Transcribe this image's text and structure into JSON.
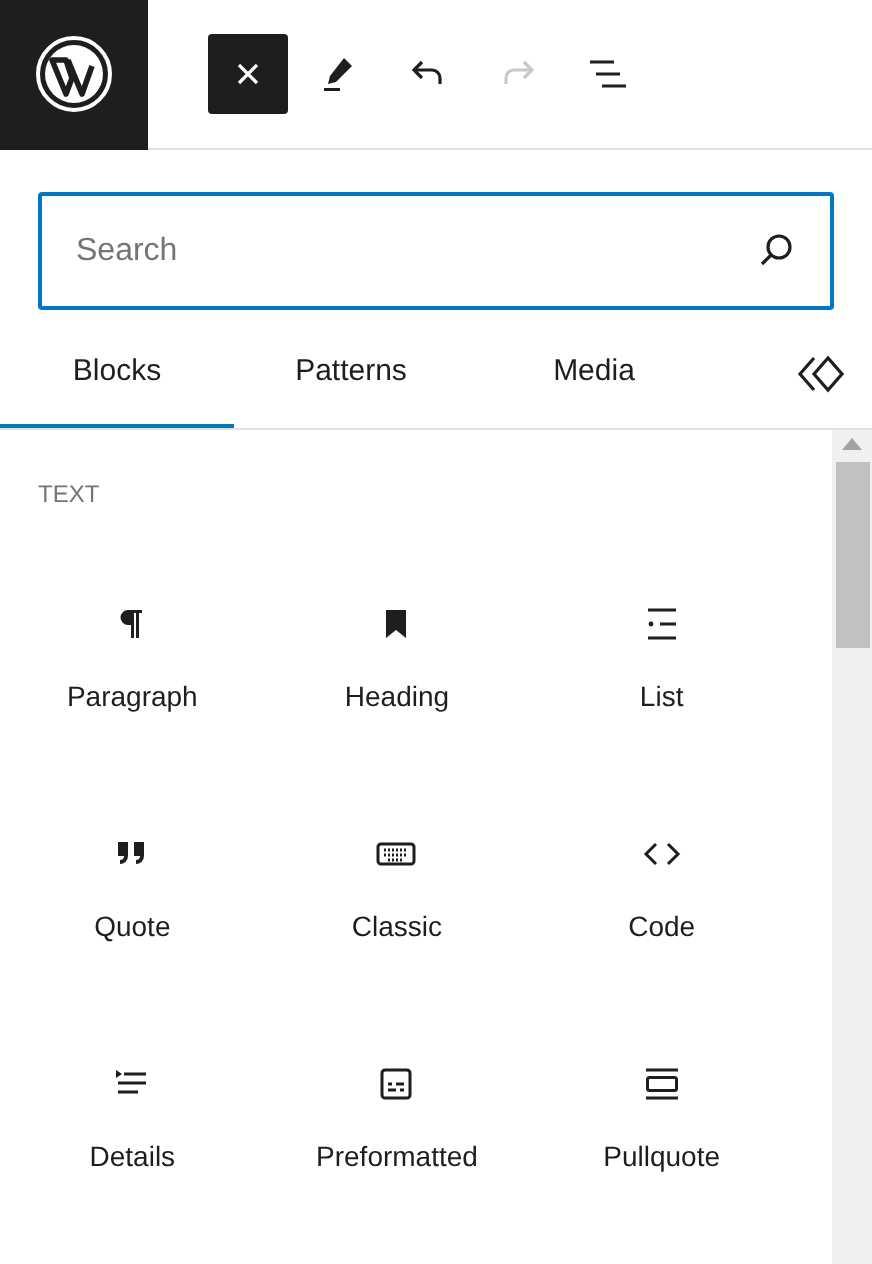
{
  "toolbar": [
    {
      "kind": "close",
      "selected": true,
      "disabled": false
    },
    {
      "kind": "edit",
      "selected": false,
      "disabled": false
    },
    {
      "kind": "undo",
      "selected": false,
      "disabled": false
    },
    {
      "kind": "redo",
      "selected": false,
      "disabled": true
    },
    {
      "kind": "outline",
      "selected": false,
      "disabled": false
    }
  ],
  "search": {
    "placeholder": "Search"
  },
  "tabs": [
    {
      "kind": "text",
      "label": "Blocks",
      "selected": true
    },
    {
      "kind": "text",
      "label": "Patterns",
      "selected": false
    },
    {
      "kind": "text",
      "label": "Media",
      "selected": false
    },
    {
      "kind": "icon",
      "selected": false
    }
  ],
  "section": {
    "title": "TEXT"
  },
  "blocks": [
    {
      "kind": "paragraph",
      "label": "Paragraph"
    },
    {
      "kind": "heading",
      "label": "Heading"
    },
    {
      "kind": "list",
      "label": "List"
    },
    {
      "kind": "quote",
      "label": "Quote"
    },
    {
      "kind": "classic",
      "label": "Classic"
    },
    {
      "kind": "code",
      "label": "Code"
    },
    {
      "kind": "details",
      "label": "Details"
    },
    {
      "kind": "preformatted",
      "label": "Preformatted"
    },
    {
      "kind": "pullquote",
      "label": "Pullquote"
    }
  ]
}
